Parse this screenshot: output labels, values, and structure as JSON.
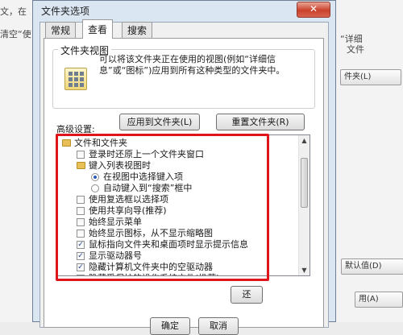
{
  "background": {
    "left_text_1": "文，在",
    "left_text_2": "清空“使",
    "right_text_1": "“详细",
    "right_text_2": "文件",
    "right_btn_1": "件夹(L)",
    "right_btn_2": "默认值(D)",
    "right_btn_3": "用(A)"
  },
  "dialog": {
    "title": "文件夹选项",
    "close_glyph": "✕",
    "tabs": [
      "常规",
      "查看",
      "搜索"
    ],
    "folder_view": {
      "title": "文件夹视图",
      "description": "可以将该文件夹正在使用的视图(例如“详细信息”或“图标”)应用到所有这种类型的文件夹中。",
      "apply_button": "应用到文件夹(L)",
      "reset_button": "重置文件夹(R)"
    },
    "advanced_label": "高级设置:",
    "tree_items": [
      {
        "type": "folder",
        "label": "文件和文件夹",
        "checked": false
      },
      {
        "type": "checkbox",
        "label": "登录时还原上一个文件夹窗口",
        "checked": false
      },
      {
        "type": "folder",
        "label": "键入列表视图时",
        "checked": false
      },
      {
        "type": "radio",
        "label": "在视图中选择键入项",
        "checked": true
      },
      {
        "type": "radio",
        "label": "自动键入到“搜索”框中",
        "checked": false
      },
      {
        "type": "checkbox",
        "label": "使用复选框以选择项",
        "checked": false
      },
      {
        "type": "checkbox",
        "label": "使用共享向导(推荐)",
        "checked": false
      },
      {
        "type": "checkbox",
        "label": "始终显示菜单",
        "checked": false
      },
      {
        "type": "checkbox",
        "label": "始终显示图标，从不显示缩略图",
        "checked": false
      },
      {
        "type": "checkbox",
        "label": "鼠标指向文件夹和桌面项时显示提示信息",
        "checked": true
      },
      {
        "type": "checkbox",
        "label": "显示驱动器号",
        "checked": true
      },
      {
        "type": "checkbox",
        "label": "隐藏计算机文件夹中的空驱动器",
        "checked": true
      },
      {
        "type": "checkbox",
        "label": "隐藏受保护的操作系统文件(推荐)",
        "checked": true
      }
    ],
    "checkmark_glyph": "✓",
    "restore_button": "还",
    "ok_button": "确定",
    "cancel_button": "取消",
    "highlight_color": "#e0141b"
  }
}
